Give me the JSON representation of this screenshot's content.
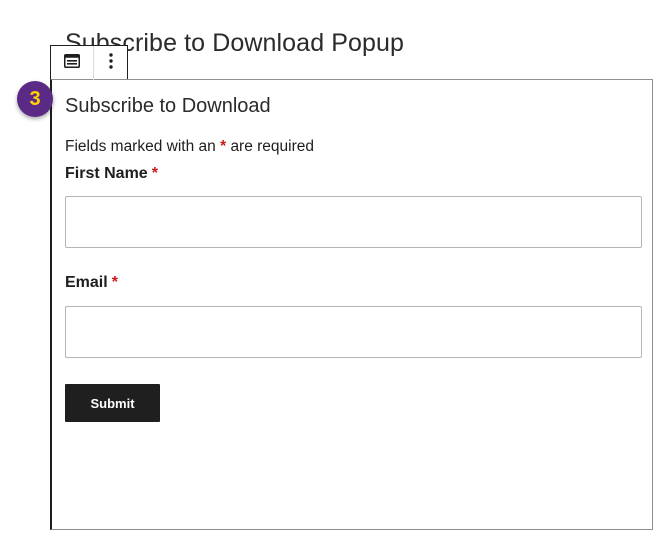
{
  "page": {
    "title": "Subscribe to Download Popup"
  },
  "toolbar": {
    "block_type_icon": "form-block-icon",
    "more_options_icon": "vertical-ellipsis-icon"
  },
  "step_badge": {
    "number": "3"
  },
  "form": {
    "heading": "Subscribe to Download",
    "required_note_prefix": "Fields marked with an",
    "required_star": "*",
    "required_note_suffix": "are required",
    "fields": [
      {
        "label": "First Name",
        "value": "",
        "placeholder": ""
      },
      {
        "label": "Email",
        "value": "",
        "placeholder": ""
      }
    ],
    "submit_label": "Submit"
  },
  "colors": {
    "badge_background": "#5a2a86",
    "badge_text": "#ffd400",
    "required_star": "#cc1818",
    "button_background": "#1f1f1f"
  }
}
